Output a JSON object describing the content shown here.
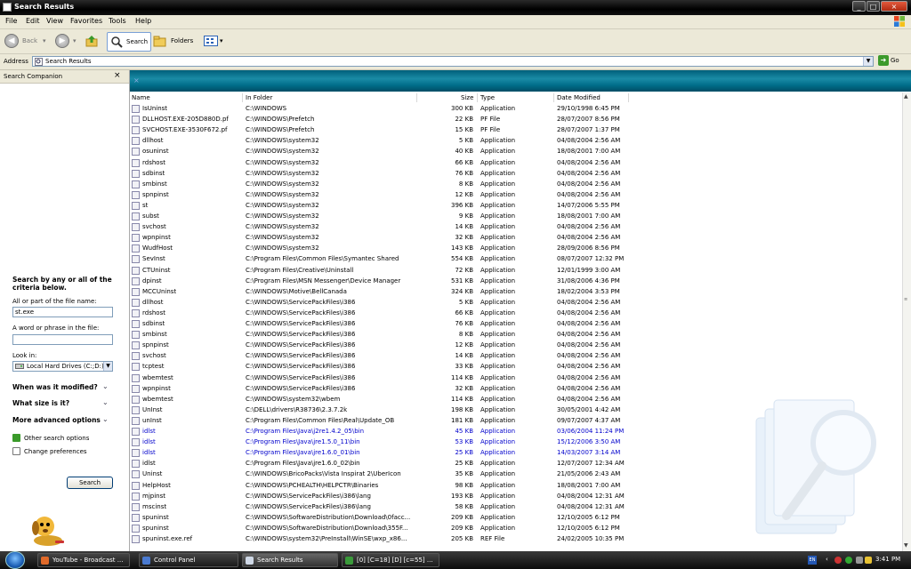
{
  "window": {
    "title": "Search Results"
  },
  "menu": [
    "File",
    "Edit",
    "View",
    "Favorites",
    "Tools",
    "Help"
  ],
  "toolbar": {
    "back": "Back",
    "search": "Search",
    "folders": "Folders"
  },
  "address": {
    "label": "Address",
    "value": "Search Results",
    "go": "Go"
  },
  "companion": {
    "title": "Search Companion",
    "close": "×",
    "heading": "Search by any or all of the criteria below.",
    "name_label": "All or part of the file name:",
    "name_value": "st.exe",
    "phrase_label": "A word or phrase in the file:",
    "phrase_value": "",
    "lookin_label": "Look in:",
    "lookin_value": "Local Hard Drives (C:;D:)",
    "when": "When was it modified?",
    "size": "What size is it?",
    "advanced": "More advanced options",
    "other": "Other search options",
    "prefs": "Change preferences",
    "search_button": "Search"
  },
  "results": {
    "columns": [
      "Name",
      "In Folder",
      "Size",
      "Type",
      "Date Modified"
    ],
    "rows": [
      [
        "IsUninst",
        "C:\\WINDOWS",
        "300 KB",
        "Application",
        "29/10/1998 6:45 PM"
      ],
      [
        "DLLHOST.EXE-205D880D.pf",
        "C:\\WINDOWS\\Prefetch",
        "22 KB",
        "PF File",
        "28/07/2007 8:56 PM"
      ],
      [
        "SVCHOST.EXE-3530F672.pf",
        "C:\\WINDOWS\\Prefetch",
        "15 KB",
        "PF File",
        "28/07/2007 1:37 PM"
      ],
      [
        "dllhost",
        "C:\\WINDOWS\\system32",
        "5 KB",
        "Application",
        "04/08/2004 2:56 AM"
      ],
      [
        "osuninst",
        "C:\\WINDOWS\\system32",
        "40 KB",
        "Application",
        "18/08/2001 7:00 AM"
      ],
      [
        "rdshost",
        "C:\\WINDOWS\\system32",
        "66 KB",
        "Application",
        "04/08/2004 2:56 AM"
      ],
      [
        "sdbinst",
        "C:\\WINDOWS\\system32",
        "76 KB",
        "Application",
        "04/08/2004 2:56 AM"
      ],
      [
        "smbinst",
        "C:\\WINDOWS\\system32",
        "8 KB",
        "Application",
        "04/08/2004 2:56 AM"
      ],
      [
        "spnpinst",
        "C:\\WINDOWS\\system32",
        "12 KB",
        "Application",
        "04/08/2004 2:56 AM"
      ],
      [
        "st",
        "C:\\WINDOWS\\system32",
        "396 KB",
        "Application",
        "14/07/2006 5:55 PM"
      ],
      [
        "subst",
        "C:\\WINDOWS\\system32",
        "9 KB",
        "Application",
        "18/08/2001 7:00 AM"
      ],
      [
        "svchost",
        "C:\\WINDOWS\\system32",
        "14 KB",
        "Application",
        "04/08/2004 2:56 AM"
      ],
      [
        "wpnpinst",
        "C:\\WINDOWS\\system32",
        "32 KB",
        "Application",
        "04/08/2004 2:56 AM"
      ],
      [
        "WudfHost",
        "C:\\WINDOWS\\system32",
        "143 KB",
        "Application",
        "28/09/2006 8:56 PM"
      ],
      [
        "SevInst",
        "C:\\Program Files\\Common Files\\Symantec Shared",
        "554 KB",
        "Application",
        "08/07/2007 12:32 PM"
      ],
      [
        "CTUninst",
        "C:\\Program Files\\Creative\\Uninstall",
        "72 KB",
        "Application",
        "12/01/1999 3:00 AM"
      ],
      [
        "dpinst",
        "C:\\Program Files\\MSN Messenger\\Device Manager",
        "531 KB",
        "Application",
        "31/08/2006 4:36 PM"
      ],
      [
        "MCCUninst",
        "C:\\WINDOWS\\Motive\\BellCanada",
        "324 KB",
        "Application",
        "18/02/2004 3:53 PM"
      ],
      [
        "dllhost",
        "C:\\WINDOWS\\ServicePackFiles\\i386",
        "5 KB",
        "Application",
        "04/08/2004 2:56 AM"
      ],
      [
        "rdshost",
        "C:\\WINDOWS\\ServicePackFiles\\i386",
        "66 KB",
        "Application",
        "04/08/2004 2:56 AM"
      ],
      [
        "sdbinst",
        "C:\\WINDOWS\\ServicePackFiles\\i386",
        "76 KB",
        "Application",
        "04/08/2004 2:56 AM"
      ],
      [
        "smbinst",
        "C:\\WINDOWS\\ServicePackFiles\\i386",
        "8 KB",
        "Application",
        "04/08/2004 2:56 AM"
      ],
      [
        "spnpinst",
        "C:\\WINDOWS\\ServicePackFiles\\i386",
        "12 KB",
        "Application",
        "04/08/2004 2:56 AM"
      ],
      [
        "svchost",
        "C:\\WINDOWS\\ServicePackFiles\\i386",
        "14 KB",
        "Application",
        "04/08/2004 2:56 AM"
      ],
      [
        "tcptest",
        "C:\\WINDOWS\\ServicePackFiles\\i386",
        "33 KB",
        "Application",
        "04/08/2004 2:56 AM"
      ],
      [
        "wbemtest",
        "C:\\WINDOWS\\ServicePackFiles\\i386",
        "114 KB",
        "Application",
        "04/08/2004 2:56 AM"
      ],
      [
        "wpnpinst",
        "C:\\WINDOWS\\ServicePackFiles\\i386",
        "32 KB",
        "Application",
        "04/08/2004 2:56 AM"
      ],
      [
        "wbemtest",
        "C:\\WINDOWS\\system32\\wbem",
        "114 KB",
        "Application",
        "04/08/2004 2:56 AM"
      ],
      [
        "UnInst",
        "C:\\DELL\\drivers\\R38736\\2.3.7.2k",
        "198 KB",
        "Application",
        "30/05/2001 4:42 AM"
      ],
      [
        "unInst",
        "C:\\Program Files\\Common Files\\Real\\Update_OB",
        "181 KB",
        "Application",
        "09/07/2007 4:37 AM"
      ],
      [
        "idlst",
        "C:\\Program Files\\Java\\j2re1.4.2_05\\bin",
        "45 KB",
        "Application",
        "03/06/2004 11:24 PM"
      ],
      [
        "idlst",
        "C:\\Program Files\\Java\\jre1.5.0_11\\bin",
        "53 KB",
        "Application",
        "15/12/2006 3:50 AM"
      ],
      [
        "idlst",
        "C:\\Program Files\\Java\\jre1.6.0_01\\bin",
        "25 KB",
        "Application",
        "14/03/2007 3:14 AM"
      ],
      [
        "idlst",
        "C:\\Program Files\\Java\\jre1.6.0_02\\bin",
        "25 KB",
        "Application",
        "12/07/2007 12:34 AM"
      ],
      [
        "Uninst",
        "C:\\WINDOWS\\BricoPacks\\Vista Inspirat 2\\UberIcon",
        "35 KB",
        "Application",
        "21/05/2006 2:43 AM"
      ],
      [
        "HelpHost",
        "C:\\WINDOWS\\PCHEALTH\\HELPCTR\\Binaries",
        "98 KB",
        "Application",
        "18/08/2001 7:00 AM"
      ],
      [
        "mjpinst",
        "C:\\WINDOWS\\ServicePackFiles\\i386\\lang",
        "193 KB",
        "Application",
        "04/08/2004 12:31 AM"
      ],
      [
        "mscinst",
        "C:\\WINDOWS\\ServicePackFiles\\i386\\lang",
        "58 KB",
        "Application",
        "04/08/2004 12:31 AM"
      ],
      [
        "spuninst",
        "C:\\WINDOWS\\SoftwareDistribution\\Download\\0facc...",
        "209 KB",
        "Application",
        "12/10/2005 6:12 PM"
      ],
      [
        "spuninst",
        "C:\\WINDOWS\\SoftwareDistribution\\Download\\355F...",
        "209 KB",
        "Application",
        "12/10/2005 6:12 PM"
      ],
      [
        "spuninst.exe.ref",
        "C:\\WINDOWS\\system32\\PreInstall\\WinSE\\wxp_x86...",
        "205 KB",
        "REF File",
        "24/02/2005 10:35 PM"
      ]
    ],
    "blue_rows": [
      30,
      31,
      32
    ]
  },
  "taskbar": {
    "tasks": [
      "YouTube - Broadcast ...",
      "Control Panel",
      "Search Results",
      "[0] [C=18] [D] [c=55] ..."
    ],
    "lang": "EN",
    "clock": "3:41 PM"
  },
  "colors": {
    "banner": "#006e8a",
    "link_blue": "#0000cc",
    "taskbar": "#0c0c0c"
  }
}
